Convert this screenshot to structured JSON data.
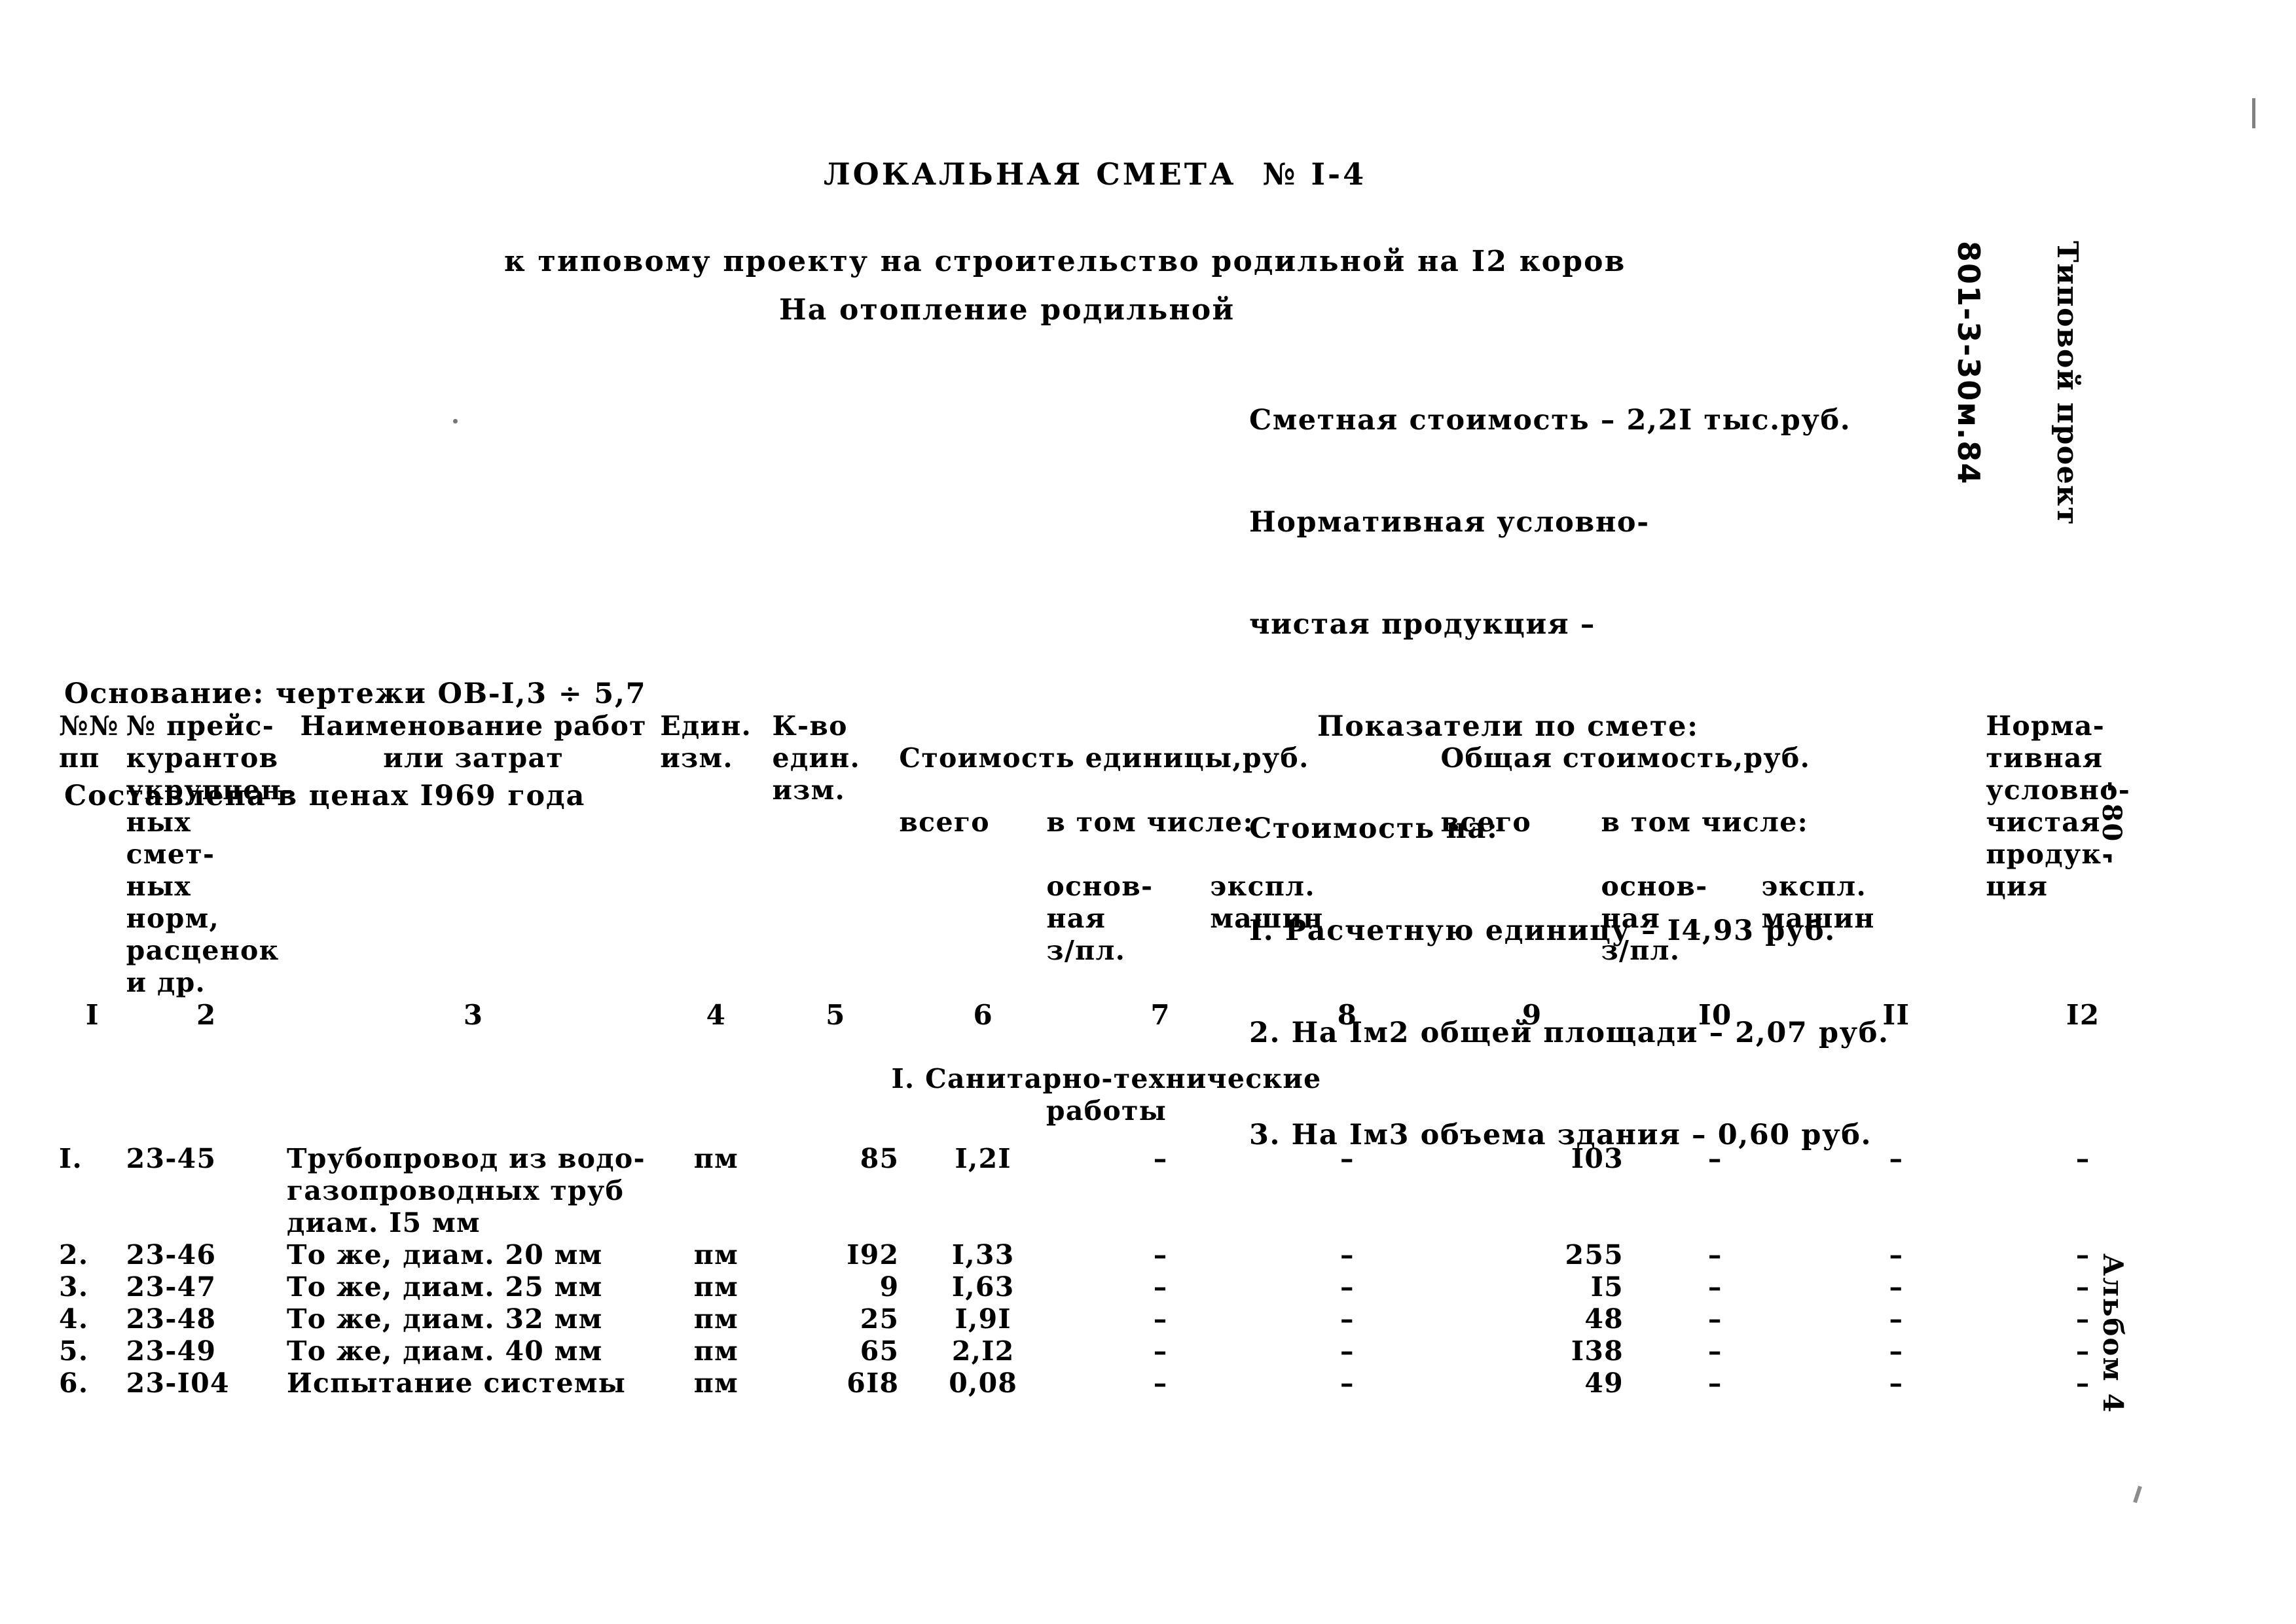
{
  "document": {
    "title": "ЛОКАЛЬНАЯ СМЕТА  № I-4",
    "subtitle_1": "к типовому проекту на строительство родильной на I2 коров",
    "subtitle_2": "На отопление родильной"
  },
  "summary": {
    "estimate_cost": "Сметная стоимость – 2,2I тыс.руб.",
    "normative_line_1": "Нормативная условно-",
    "normative_line_2": "чистая продукция –",
    "indicators_heading": "Показатели по смете:",
    "cost_per_heading": "Стоимость на:",
    "item_1": "I. Расчетную единицу – I4,93 руб.",
    "item_2": "2. На Iм2 общей площади – 2,07 руб.",
    "item_3": "3. На Iм3 объема здания – 0,60 руб."
  },
  "basis": {
    "line_1": "Основание: чертежи ОВ-I,3 ÷ 5,7",
    "line_2": "Составлена в ценах I969 года"
  },
  "table": {
    "headers": {
      "col1": "№№\nпп",
      "col2": "№ прейс-\nкурантов\nукрупнен-\nных смет-\nных норм,\nрасценок\nи др.",
      "col3": "Наименование работ\nили затрат",
      "col4": "Един.\nизм.",
      "col5": "К-во\nедин.\nизм.",
      "group_unit": "Стоимость единицы,руб.",
      "col6": "всего",
      "group_unit_incl": "в том числе:",
      "col7": "основ-\nная\nз/пл.",
      "col8": "экспл.\nмашин",
      "group_total": "Общая стоимость,руб.",
      "col9": "всего",
      "group_total_incl": "в том числе:",
      "col10": "основ-\nная\nз/пл.",
      "col11": "экспл.\nмашин",
      "col12": "Норма-\nтивная\nусловно-\nчистая\nпродук-\nция"
    },
    "column_numbers": [
      "I",
      "2",
      "3",
      "4",
      "5",
      "6",
      "7",
      "8",
      "9",
      "I0",
      "II",
      "I2"
    ],
    "group_title": "I. Санитарно-технические\nработы",
    "rows": [
      {
        "no": "I.",
        "code": "23-45",
        "name": "Трубопровод из водо-\nгазопроводных труб\nдиам. I5 мм",
        "unit": "пм",
        "qty": "85",
        "unit_total": "I,2I",
        "unit_wage": "–",
        "unit_machine": "–",
        "total": "I03",
        "total_wage": "–",
        "total_machine": "–",
        "nchp": "–"
      },
      {
        "no": "2.",
        "code": "23-46",
        "name": "То же, диам. 20 мм",
        "unit": "пм",
        "qty": "I92",
        "unit_total": "I,33",
        "unit_wage": "–",
        "unit_machine": "–",
        "total": "255",
        "total_wage": "–",
        "total_machine": "–",
        "nchp": "–"
      },
      {
        "no": "3.",
        "code": "23-47",
        "name": "То же, диам. 25 мм",
        "unit": "пм",
        "qty": "9",
        "unit_total": "I,63",
        "unit_wage": "–",
        "unit_machine": "–",
        "total": "I5",
        "total_wage": "–",
        "total_machine": "–",
        "nchp": "–"
      },
      {
        "no": "4.",
        "code": "23-48",
        "name": "То же, диам. 32 мм",
        "unit": "пм",
        "qty": "25",
        "unit_total": "I,9I",
        "unit_wage": "–",
        "unit_machine": "–",
        "total": "48",
        "total_wage": "–",
        "total_machine": "–",
        "nchp": "–"
      },
      {
        "no": "5.",
        "code": "23-49",
        "name": "То же, диам. 40 мм",
        "unit": "пм",
        "qty": "65",
        "unit_total": "2,I2",
        "unit_wage": "–",
        "unit_machine": "–",
        "total": "I38",
        "total_wage": "–",
        "total_machine": "–",
        "nchp": "–"
      },
      {
        "no": "6.",
        "code": "23-I04",
        "name": "Испытание системы",
        "unit": "пм",
        "qty": "6I8",
        "unit_total": "0,08",
        "unit_wage": "–",
        "unit_machine": "–",
        "total": "49",
        "total_wage": "–",
        "total_machine": "–",
        "nchp": "–"
      }
    ]
  },
  "margins": {
    "project_label": "Типовой проект",
    "project_code": "801-3-30м.84",
    "page_number": "- 80 -",
    "album": "Альбом 4"
  }
}
